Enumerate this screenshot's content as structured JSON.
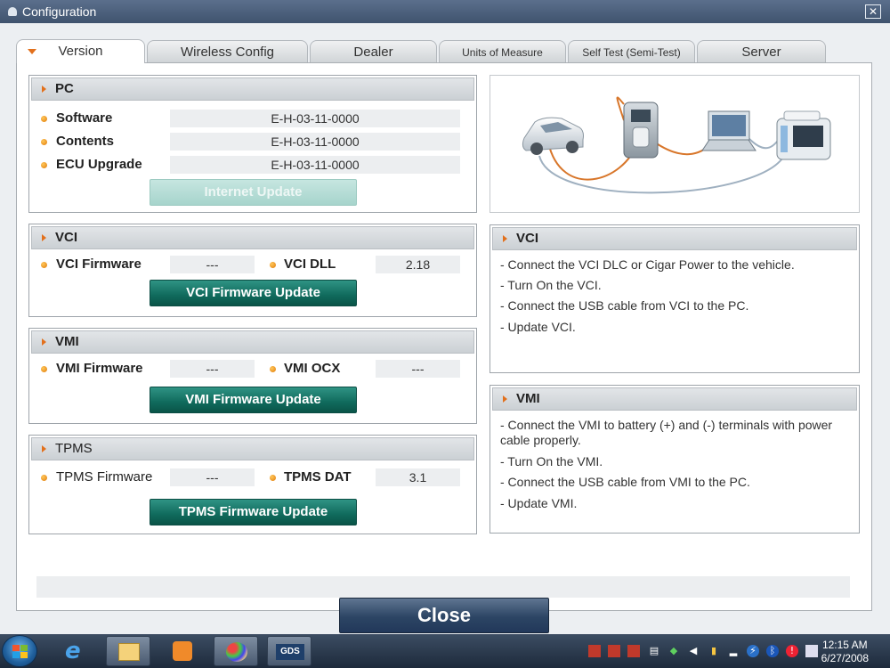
{
  "window": {
    "title": "Configuration",
    "close_glyph": "✕"
  },
  "tabs": [
    {
      "label": "Version",
      "active": true
    },
    {
      "label": "Wireless Config",
      "active": false
    },
    {
      "label": "Dealer",
      "active": false
    },
    {
      "label": "Units of Measure",
      "active": false
    },
    {
      "label": "Self Test (Semi-Test)",
      "active": false
    },
    {
      "label": "Server",
      "active": false
    }
  ],
  "pc": {
    "header": "PC",
    "software_label": "Software",
    "software_value": "E-H-03-11-0000",
    "contents_label": "Contents",
    "contents_value": "E-H-03-11-0000",
    "ecu_label": "ECU Upgrade",
    "ecu_value": "E-H-03-11-0000",
    "update_button": "Internet Update"
  },
  "vci": {
    "header": "VCI",
    "firmware_label": "VCI Firmware",
    "firmware_value": "---",
    "dll_label": "VCI DLL",
    "dll_value": "2.18",
    "update_button": "VCI Firmware Update"
  },
  "vmi": {
    "header": "VMI",
    "firmware_label": "VMI Firmware",
    "firmware_value": "---",
    "ocx_label": "VMI OCX",
    "ocx_value": "---",
    "update_button": "VMI Firmware Update"
  },
  "tpms": {
    "header": "TPMS",
    "firmware_label": "TPMS Firmware",
    "firmware_value": "---",
    "dat_label": "TPMS DAT",
    "dat_value": "3.1",
    "update_button": "TPMS Firmware Update"
  },
  "vci_info": {
    "header": "VCI",
    "steps": [
      "- Connect the VCI DLC or Cigar Power to the vehicle.",
      "- Turn On the VCI.",
      "- Connect the USB cable from VCI to the PC.",
      "- Update VCI."
    ]
  },
  "vmi_info": {
    "header": "VMI",
    "steps": [
      "- Connect the VMI to battery (+) and (-) terminals with power cable properly.",
      "- Turn On the VMI.",
      "- Connect the USB cable from VMI to the PC.",
      "- Update VMI."
    ]
  },
  "close_button": "Close",
  "taskbar": {
    "gds_label": "GDS",
    "clock_time": "12:15 AM",
    "clock_date": "6/27/2008"
  },
  "colors": {
    "accent_orange": "#e2701c",
    "button_teal": "#106a5c",
    "close_navy": "#2c4564"
  }
}
